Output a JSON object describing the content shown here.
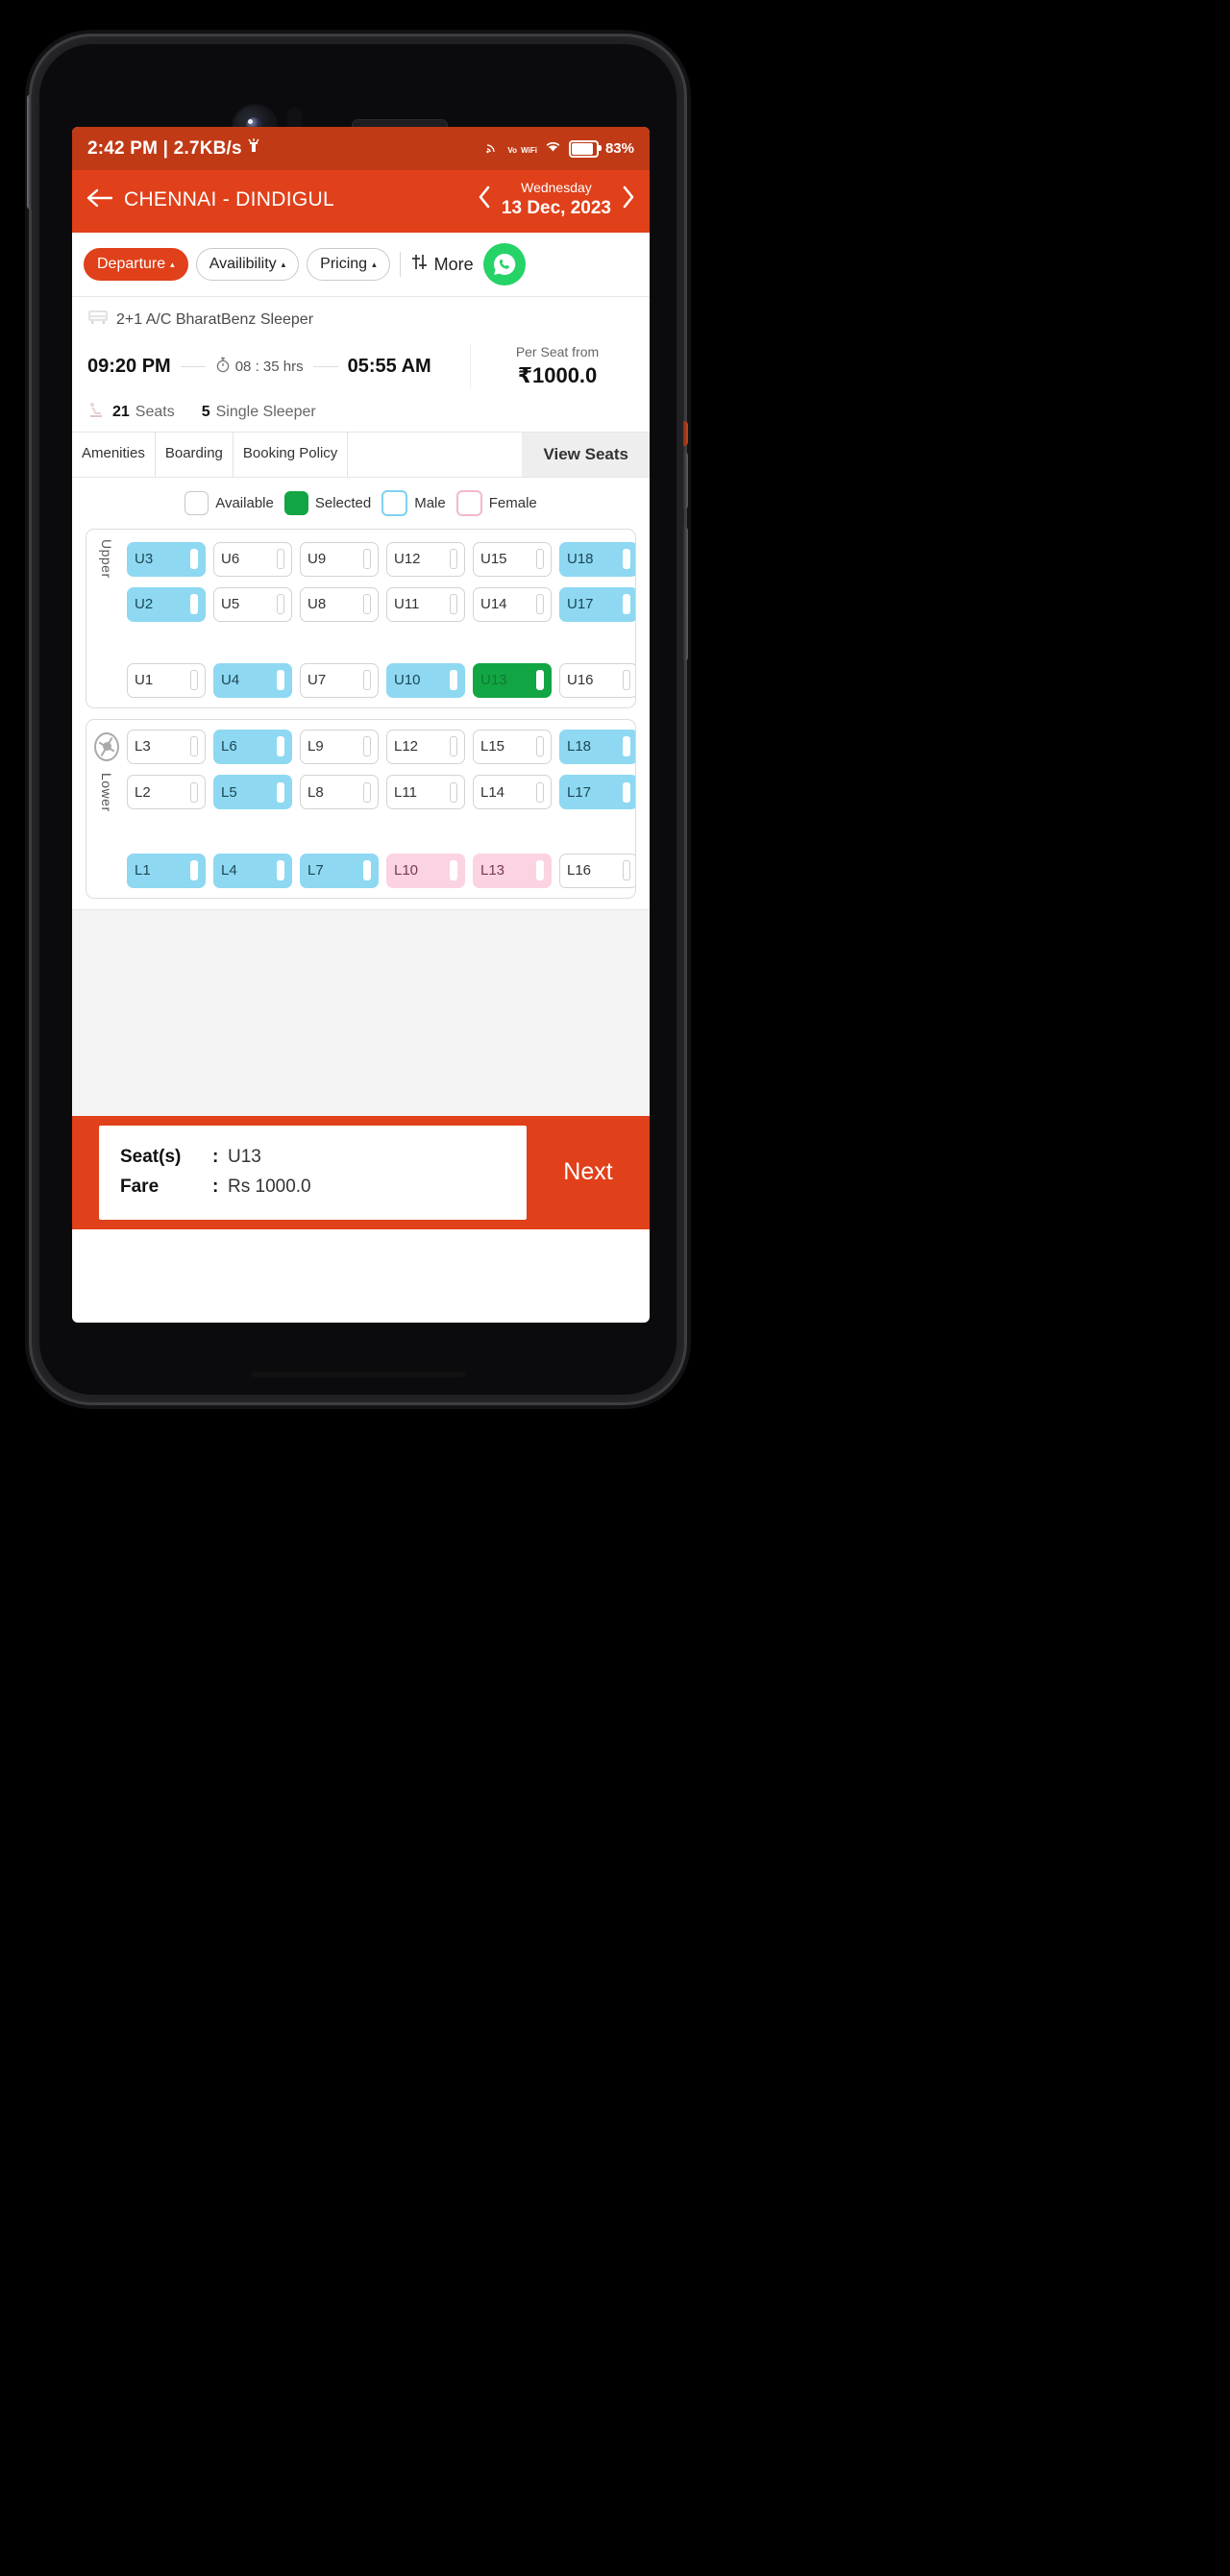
{
  "status_bar": {
    "time_and_network": "2:42 PM | 2.7KB/s",
    "cast_icon": "cast-icon",
    "volte_top": "Vo",
    "volte_bottom": "WiFi",
    "wifi_icon": "wifi-icon",
    "battery_icon": "battery-icon",
    "battery_text": "83%"
  },
  "header": {
    "back_icon": "back-arrow-icon",
    "route": "CHENNAI - DINDIGUL",
    "prev_icon": "chevron-left-icon",
    "next_icon": "chevron-right-icon",
    "day_name": "Wednesday",
    "date": "13 Dec, 2023"
  },
  "filters": {
    "chips": [
      {
        "label": "Departure",
        "caret": "▴",
        "active": true
      },
      {
        "label": "Availibility",
        "caret": "▴",
        "active": false
      },
      {
        "label": "Pricing",
        "caret": "▴",
        "active": false
      }
    ],
    "more_icon": "sliders-icon",
    "more_label": "More",
    "whatsapp_icon": "whatsapp-icon"
  },
  "bus": {
    "bus_icon": "bus-icon",
    "type": "2+1 A/C BharatBenz Sleeper",
    "departure_time": "09:20 PM",
    "clock_icon": "stopwatch-icon",
    "duration": "08 : 35 hrs",
    "arrival_time": "05:55 AM",
    "per_seat_label": "Per Seat from",
    "price": "₹1000.0",
    "seat_icon": "seat-icon",
    "seats_count": "21",
    "seats_label": "Seats",
    "single_count": "5",
    "single_label": "Single Sleeper"
  },
  "tabs": [
    {
      "label": "Amenities",
      "active": false
    },
    {
      "label": "Boarding",
      "active": false
    },
    {
      "label": "Booking Policy",
      "active": false
    },
    {
      "label": "View Seats",
      "active": true
    }
  ],
  "legend": [
    {
      "label": "Available",
      "state": "available"
    },
    {
      "label": "Selected",
      "state": "selected"
    },
    {
      "label": "Male",
      "state": "male"
    },
    {
      "label": "Female",
      "state": "female"
    }
  ],
  "seat_map": {
    "upper": {
      "deck_label": "Upper",
      "rows": [
        [
          {
            "id": "U3",
            "state": "male"
          },
          {
            "id": "U6",
            "state": "available"
          },
          {
            "id": "U9",
            "state": "available"
          },
          {
            "id": "U12",
            "state": "available"
          },
          {
            "id": "U15",
            "state": "available"
          },
          {
            "id": "U18",
            "state": "male"
          }
        ],
        [
          {
            "id": "U2",
            "state": "male"
          },
          {
            "id": "U5",
            "state": "available"
          },
          {
            "id": "U8",
            "state": "available"
          },
          {
            "id": "U11",
            "state": "available"
          },
          {
            "id": "U14",
            "state": "available"
          },
          {
            "id": "U17",
            "state": "male"
          }
        ],
        [
          {
            "id": "U1",
            "state": "available"
          },
          {
            "id": "U4",
            "state": "male"
          },
          {
            "id": "U7",
            "state": "available"
          },
          {
            "id": "U10",
            "state": "male"
          },
          {
            "id": "U13",
            "state": "selected"
          },
          {
            "id": "U16",
            "state": "available"
          }
        ]
      ]
    },
    "lower": {
      "deck_label": "Lower",
      "wheel_icon": "steering-wheel-icon",
      "rows": [
        [
          {
            "id": "L3",
            "state": "available"
          },
          {
            "id": "L6",
            "state": "male"
          },
          {
            "id": "L9",
            "state": "available"
          },
          {
            "id": "L12",
            "state": "available"
          },
          {
            "id": "L15",
            "state": "available"
          },
          {
            "id": "L18",
            "state": "male"
          }
        ],
        [
          {
            "id": "L2",
            "state": "available"
          },
          {
            "id": "L5",
            "state": "male"
          },
          {
            "id": "L8",
            "state": "available"
          },
          {
            "id": "L11",
            "state": "available"
          },
          {
            "id": "L14",
            "state": "available"
          },
          {
            "id": "L17",
            "state": "male"
          }
        ],
        [
          {
            "id": "L1",
            "state": "male"
          },
          {
            "id": "L4",
            "state": "male"
          },
          {
            "id": "L7",
            "state": "male"
          },
          {
            "id": "L10",
            "state": "female"
          },
          {
            "id": "L13",
            "state": "female"
          },
          {
            "id": "L16",
            "state": "available"
          }
        ]
      ]
    }
  },
  "bottom_bar": {
    "seats_key": "Seat(s)",
    "seats_sep": ":",
    "seats_value": "U13",
    "fare_key": "Fare",
    "fare_sep": ":",
    "fare_value": "Rs 1000.0",
    "next_label": "Next"
  },
  "colors": {
    "brand": "#e0401a",
    "status_bar": "#c13a16",
    "selected": "#12a544",
    "male": "#8ed8f2",
    "female": "#fbd3e2",
    "whatsapp": "#25d366"
  }
}
